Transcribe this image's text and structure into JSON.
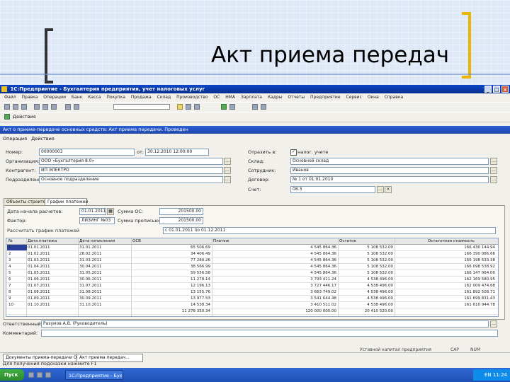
{
  "slide": {
    "title": "Акт приема передач"
  },
  "app": {
    "title": "1С:Предприятие - Бухгалтерия предприятия, учет налоговых услуг",
    "menu": [
      "Файл",
      "Правка",
      "Операции",
      "Банк",
      "Касса",
      "Покупка",
      "Продажа",
      "Склад",
      "Производство",
      "ОС",
      "НМА",
      "Зарплата",
      "Кадры",
      "Отчеты",
      "Предприятие",
      "Сервис",
      "Окна",
      "Справка"
    ],
    "toolbar2_label": "Действия"
  },
  "doc": {
    "title": "Акт о приеме-передаче основных средств: Акт приема передачи. Проведен",
    "actions": [
      "Операция",
      "Действия"
    ],
    "fields": {
      "nomer_label": "Номер:",
      "nomer": "00000003",
      "ot_label": "от:",
      "ot": "30.12.2010 12:00:00",
      "org_label": "Организация:",
      "org": "ООО «Бухгалтерия 8.0»",
      "kontr_label": "Контрагент:",
      "kontr": "ИП ЭЛЕКТРО",
      "podr_label": "Подразделение:",
      "podr": "Основное подразделение",
      "otrazh_label": "Отразить в:",
      "otrazh": "налог. учете",
      "sklad_label": "Склад:",
      "sklad": "Основной склад",
      "sotr_label": "Сотрудник:",
      "sotr": "Иванов",
      "dogovor_label": "Договор:",
      "dogovor": "№ 1 от 01.01.2010",
      "schet_label": "Счет:",
      "schet": "08.3"
    },
    "tabs": [
      "Объекты строительства",
      "График платежей"
    ],
    "sub": {
      "date_label": "Дата начала расчетов:",
      "date": "01.01.2011",
      "sum_label": "Сумма ОС:",
      "sum": "201500.00",
      "faktor_label": "Фактор:",
      "faktor": "ЛИЗИНГ №03",
      "sumpr_label": "Сумма прописью:",
      "sumpr": "201500.00",
      "calc_label": "Рассчитать график платежей",
      "calc_val": "с 01.01.2011 по 01.12.2011"
    },
    "grid": {
      "headers": [
        "№",
        "Дата платежа",
        "Дата начисления",
        "ОСВ",
        "Платеж",
        "Остаток",
        "Остаточная стоимость"
      ],
      "rows": [
        [
          "1",
          "01.01.2011",
          "31.01.2011",
          "65 506.69",
          "4 545 864.36",
          "5 108 532.00",
          "166 430 144.94"
        ],
        [
          "2",
          "01.02.2011",
          "28.02.2011",
          "34 406.49",
          "4 545 864.36",
          "5 108 532.00",
          "166 390 086.66"
        ],
        [
          "3",
          "01.03.2011",
          "31.03.2011",
          "77 280.26",
          "4 545 864.36",
          "5 108 532.00",
          "166 198 633.38"
        ],
        [
          "4",
          "01.04.2011",
          "30.04.2011",
          "38 566.99",
          "4 545 864.36",
          "5 108 532.00",
          "166 098 538.92"
        ],
        [
          "5",
          "01.05.2011",
          "31.05.2011",
          "59 556.58",
          "4 545 864.36",
          "5 108 532.00",
          "166 147 064.00"
        ],
        [
          "6",
          "01.06.2011",
          "30.06.2011",
          "11 278.14",
          "3 793 411.24",
          "4 538 496.00",
          "162 169 580.95"
        ],
        [
          "7",
          "01.07.2011",
          "31.07.2011",
          "12 196.13",
          "3 727 446.17",
          "4 538 496.00",
          "162 009 474.68"
        ],
        [
          "8",
          "01.08.2011",
          "31.08.2011",
          "13 155.76",
          "3 663 749.02",
          "4 538 496.00",
          "161 892 508.71"
        ],
        [
          "9",
          "01.09.2011",
          "30.09.2011",
          "13 977.53",
          "3 541 644.48",
          "4 538 496.00",
          "161 699 831.43"
        ],
        [
          "10",
          "01.10.2011",
          "31.10.2011",
          "14 538.34",
          "3 410 511.02",
          "4 538 496.00",
          "161 610 944.78"
        ],
        [
          "",
          "",
          "",
          "11 278 350.34",
          "120 000 000.00",
          "20 410 520.00",
          ""
        ]
      ]
    },
    "otvetstvenny_label": "Ответственный:",
    "otvetstvenny": "Разумов А.В. (Руководитель)",
    "komment_label": "Комментарий:"
  },
  "status": {
    "right": "Уставной капитал предприятия",
    "caps": "CAP",
    "num": "NUM",
    "wintabs": [
      "Документы приема-передачи ОС",
      "Акт приема передач..."
    ],
    "hint": "Для получения подсказки нажмите F1"
  },
  "taskbar": {
    "start": "Пуск",
    "items": [
      "1С:Предприятие - Бух"
    ],
    "tray": "EN 11:24"
  }
}
